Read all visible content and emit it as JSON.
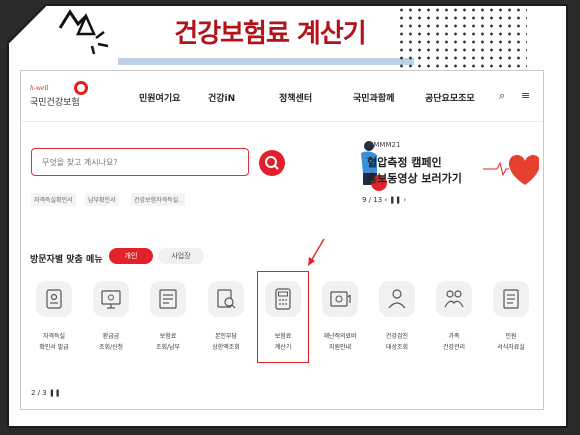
{
  "slide": {
    "title": "건강보험료 계산기"
  },
  "site": {
    "logo_small": "h-well",
    "logo_main": "국민건강보험",
    "nav": [
      "민원여기요",
      "건강iN",
      "정책센터",
      "국민과함께",
      "공단요모조모"
    ],
    "search_placeholder": "무엇을 찾고 계시나요?",
    "quick_chips": [
      "자격득실확인서",
      "납부확인서",
      "건강보험자격득실.."
    ]
  },
  "banner": {
    "tag": "K-MMM21",
    "line1": "혈압측정 캠페인",
    "line2": "홍보동영상 보러가기",
    "pager": "9 / 13  ‹  ❚❚  ›"
  },
  "menu": {
    "title": "방문자별 맞춤 메뉴",
    "tabs": [
      "개인",
      "사업장"
    ],
    "items": [
      {
        "label": "자격득실\n확인서 발급",
        "icon": "id-card-icon"
      },
      {
        "label": "환급금\n조회/신청",
        "icon": "monitor-refund-icon"
      },
      {
        "label": "보험료\n조회/납부",
        "icon": "bill-icon"
      },
      {
        "label": "본인부담\n상한액조회",
        "icon": "search-document-icon"
      },
      {
        "label": "보험료\n계산기",
        "icon": "calculator-icon"
      },
      {
        "label": "재난적의료비\n지원안내",
        "icon": "medical-support-icon"
      },
      {
        "label": "건강검진\n대상조회",
        "icon": "person-check-icon"
      },
      {
        "label": "가족\n건강관리",
        "icon": "family-icon"
      },
      {
        "label": "민원\n서식자료실",
        "icon": "form-document-icon"
      }
    ],
    "pager": "2 / 3   ❚❚"
  },
  "colors": {
    "accent": "#e3212b",
    "title": "#b3121b"
  }
}
